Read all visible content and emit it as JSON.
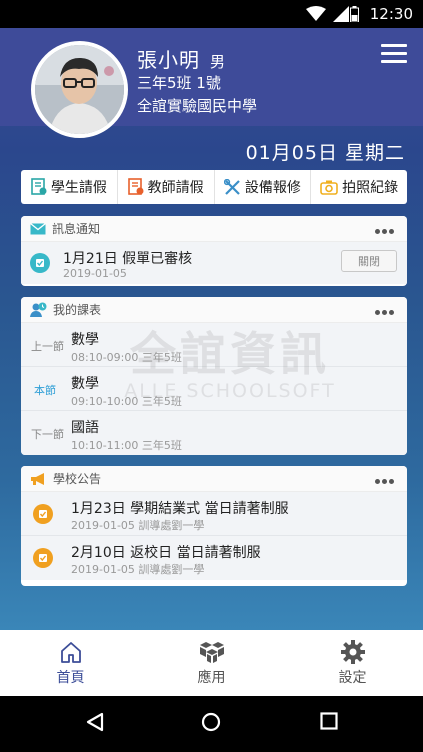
{
  "status_bar": {
    "time": "12:30"
  },
  "profile": {
    "name": "張小明",
    "gender": "男",
    "class": "三年5班 1號",
    "school": "全誼實驗國民中學"
  },
  "date": "01月05日 星期二",
  "quick_actions": [
    {
      "label": "學生請假",
      "icon": "student-leave-icon"
    },
    {
      "label": "教師請假",
      "icon": "teacher-leave-icon"
    },
    {
      "label": "設備報修",
      "icon": "repair-tools-icon"
    },
    {
      "label": "拍照紀錄",
      "icon": "camera-icon"
    }
  ],
  "notice": {
    "title": "訊息通知",
    "item": {
      "text": "1月21日 假單已審核",
      "date": "2019-01-05",
      "close_label": "關閉"
    }
  },
  "schedule": {
    "title": "我的課表",
    "rows": [
      {
        "slot": "上一節",
        "subject": "數學",
        "detail": "08:10-09:00 三年5班"
      },
      {
        "slot": "本節",
        "subject": "數學",
        "detail": "09:10-10:00 三年5班"
      },
      {
        "slot": "下一節",
        "subject": "國語",
        "detail": "10:10-11:00 三年5班"
      }
    ]
  },
  "announcements": {
    "title": "學校公告",
    "items": [
      {
        "text": "1月23日 學期結業式 當日請著制服",
        "meta": "2019-01-05 訓導處劉一學"
      },
      {
        "text": "2月10日 返校日 當日請著制服",
        "meta": "2019-01-05 訓導處劉一學"
      }
    ]
  },
  "watermark": {
    "line1": "全誼資訊",
    "line2": "ALLE SCHOOLSOFT"
  },
  "tabs": [
    {
      "label": "首頁",
      "icon": "home-icon",
      "active": true
    },
    {
      "label": "應用",
      "icon": "apps-cube-icon",
      "active": false
    },
    {
      "label": "設定",
      "icon": "gear-icon",
      "active": false
    }
  ],
  "colors": {
    "header": "#3e4b99",
    "accent_teal": "#38b8c8",
    "accent_orange": "#f0a020",
    "current_slot": "#2e9ed6"
  }
}
